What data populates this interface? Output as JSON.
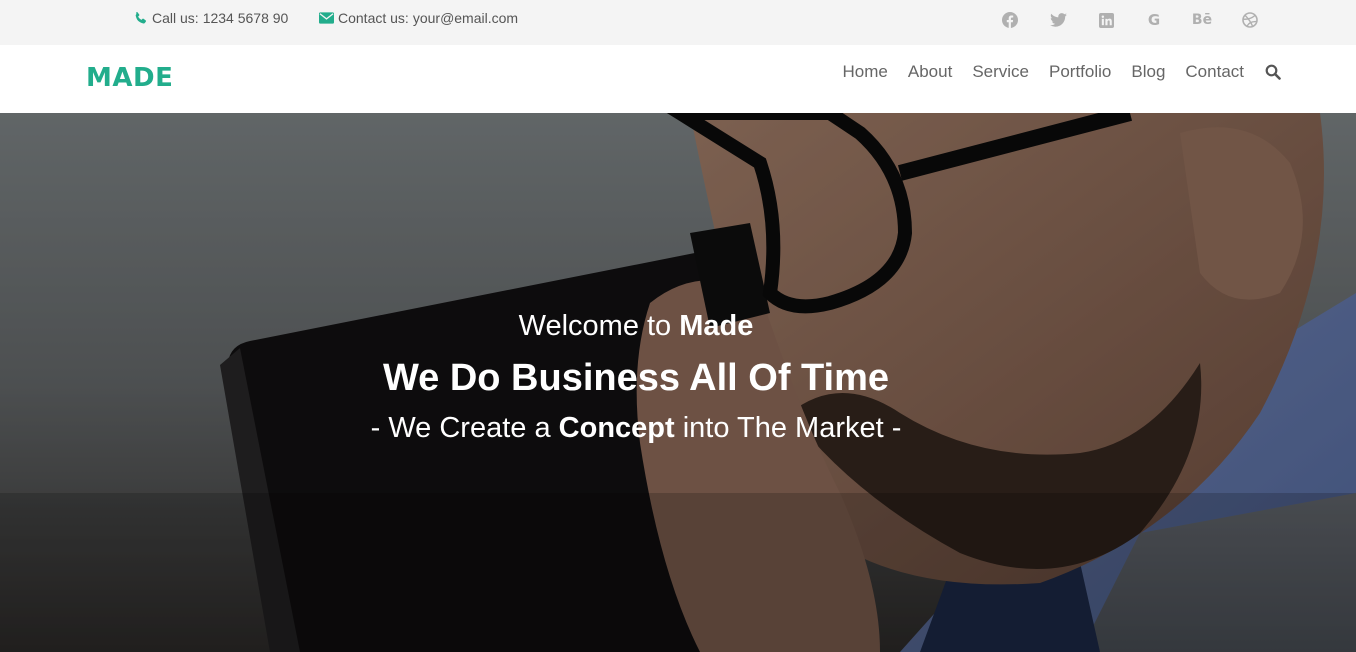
{
  "colors": {
    "accent": "#22ad8c",
    "topbar_bg": "#f4f4f4",
    "nav_text": "#666666",
    "social_icon": "#b0b0b0",
    "hero_text": "#ffffff"
  },
  "topbar": {
    "phone": {
      "icon": "phone-icon",
      "prefix": "Call us:",
      "value": "1234 5678 90"
    },
    "email": {
      "icon": "envelope-icon",
      "prefix": "Contact us:",
      "value": "your@email.com"
    },
    "social": [
      {
        "name": "facebook",
        "icon": "facebook-icon"
      },
      {
        "name": "twitter",
        "icon": "twitter-icon"
      },
      {
        "name": "linkedin",
        "icon": "linkedin-icon"
      },
      {
        "name": "google",
        "icon": "google-icon",
        "glyph": "G"
      },
      {
        "name": "behance",
        "icon": "behance-icon",
        "glyph": "Bē"
      },
      {
        "name": "dribbble",
        "icon": "dribbble-icon"
      }
    ]
  },
  "navbar": {
    "logo": "MADE",
    "menu": [
      "Home",
      "About",
      "Service",
      "Portfolio",
      "Blog",
      "Contact"
    ],
    "search_icon": "search-icon"
  },
  "hero": {
    "welcome_prefix": "Welcome to",
    "welcome_brand": "Made",
    "title": "We Do Business All Of Time",
    "sub_prefix": "- We Create a",
    "sub_bold": "Concept",
    "sub_suffix": "into The Market -"
  }
}
